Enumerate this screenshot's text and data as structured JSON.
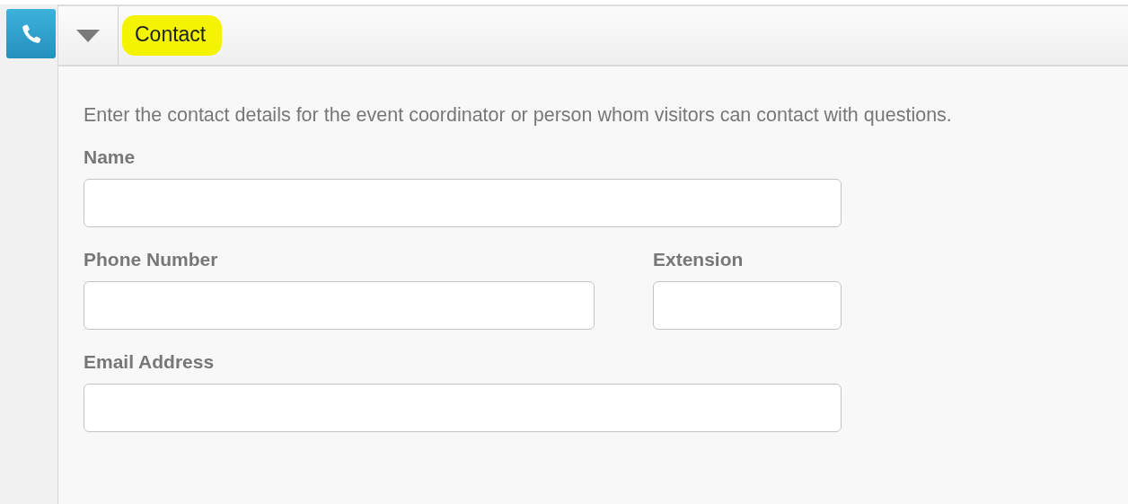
{
  "section": {
    "title": "Contact",
    "expanded": true,
    "highlighted": true,
    "description": "Enter the contact details for the event coordinator or person whom visitors can contact with questions.",
    "rows": [
      {
        "fields": [
          {
            "label": "Name"
          }
        ]
      },
      {
        "fields": [
          {
            "label": "Phone Number"
          },
          {
            "label": "Extension"
          }
        ]
      },
      {
        "fields": [
          {
            "label": "Email Address"
          }
        ]
      }
    ]
  }
}
